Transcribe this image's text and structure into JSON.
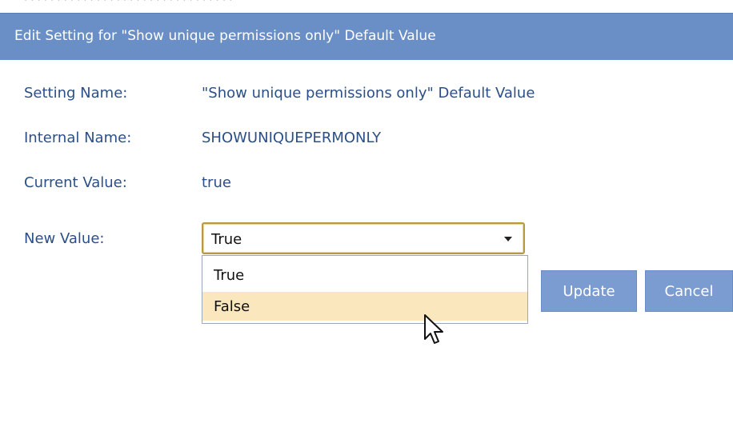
{
  "dialog": {
    "title": "Edit Setting for \"Show unique permissions only\" Default Value"
  },
  "fields": {
    "setting_name_label": "Setting Name:",
    "setting_name_value": "\"Show unique permissions only\" Default Value",
    "internal_name_label": "Internal Name:",
    "internal_name_value": "SHOWUNIQUEPERMONLY",
    "current_value_label": "Current Value:",
    "current_value_value": "true",
    "new_value_label": "New Value:"
  },
  "select": {
    "selected": "True",
    "options": [
      "True",
      "False"
    ],
    "hovered_option": "False"
  },
  "buttons": {
    "update_label": "Update",
    "cancel_label": "Cancel"
  },
  "colors": {
    "title_bar": "#6a8fc6",
    "label_text": "#2b4f86",
    "button_bg": "#7b9cd0",
    "hover_bg": "#fbe7bd"
  },
  "icons": {
    "dropdown_arrow": "chevron-down-icon",
    "cursor": "arrow-cursor-icon"
  }
}
